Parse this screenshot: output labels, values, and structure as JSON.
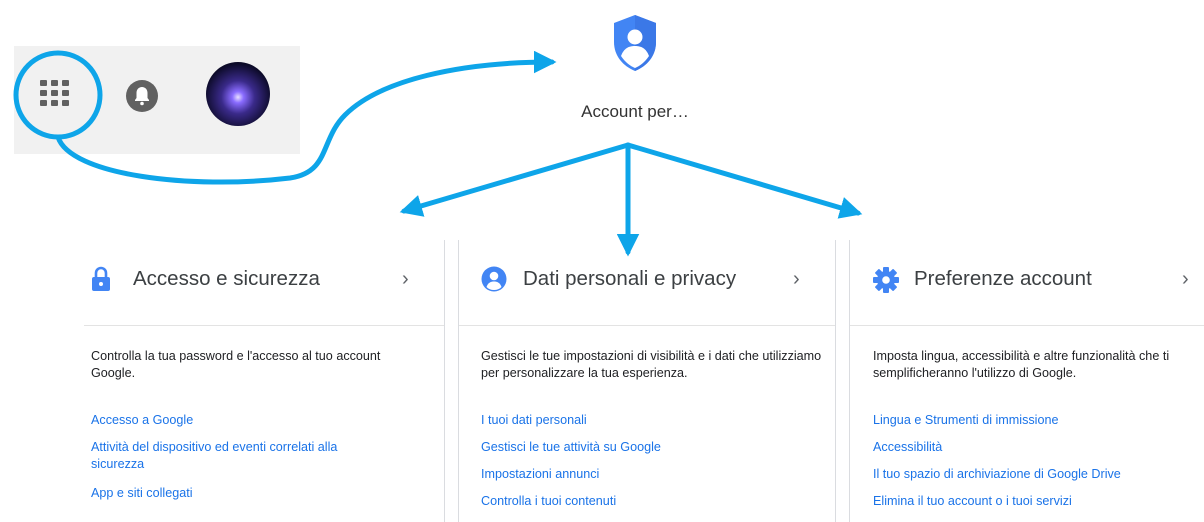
{
  "account_tile": {
    "label": "Account per…"
  },
  "cards": [
    {
      "title": "Accesso e sicurezza",
      "icon": "lock-icon",
      "description": "Controlla la tua password e l'accesso al tuo account Google.",
      "links": [
        "Accesso a Google",
        "Attività del dispositivo ed eventi correlati alla sicurezza",
        "App e siti collegati"
      ]
    },
    {
      "title": "Dati personali e privacy",
      "icon": "person-icon",
      "description": "Gestisci le tue impostazioni di visibilità e i dati che utilizziamo per personalizzare la tua esperienza.",
      "links": [
        "I tuoi dati personali",
        "Gestisci le tue attività su Google",
        "Impostazioni annunci",
        "Controlla i tuoi contenuti"
      ]
    },
    {
      "title": "Preferenze account",
      "icon": "gear-icon",
      "description": "Imposta lingua, accessibilità e altre funzionalità che ti semplificheranno l'utilizzo di Google.",
      "links": [
        "Lingua e Strumenti di immissione",
        "Accessibilità",
        "Il tuo spazio di archiviazione di Google Drive",
        "Elimina il tuo account o i tuoi servizi"
      ]
    }
  ],
  "colors": {
    "accent": "#4285f4",
    "link": "#1a73e8",
    "annotation": "#0ea5e9"
  }
}
